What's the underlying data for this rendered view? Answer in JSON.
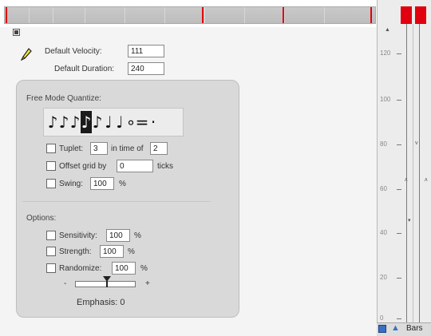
{
  "default_velocity": {
    "label": "Default Velocity:",
    "value": "111"
  },
  "default_duration": {
    "label": "Default Duration:",
    "value": "240"
  },
  "quantize": {
    "title": "Free Mode Quantize:",
    "notes": [
      {
        "glyph": "♪",
        "icon": "sixty-fourth-note-icon",
        "selected": false
      },
      {
        "glyph": "♪",
        "icon": "thirty-second-note-icon",
        "selected": false
      },
      {
        "glyph": "♪",
        "icon": "sixteenth-note-icon",
        "selected": false
      },
      {
        "glyph": "♪",
        "icon": "eighth-note-icon",
        "selected": true
      },
      {
        "glyph": "♪",
        "icon": "eighth-note-icon",
        "selected": false
      },
      {
        "glyph": "♩",
        "icon": "quarter-note-icon",
        "selected": false
      },
      {
        "glyph": "♩",
        "icon": "half-note-icon",
        "selected": false
      },
      {
        "glyph": "∘",
        "icon": "whole-note-icon",
        "selected": false
      },
      {
        "glyph": "=",
        "icon": "double-whole-note-icon",
        "selected": false
      },
      {
        "glyph": "·",
        "icon": "dotted-modifier-icon",
        "selected": false
      }
    ],
    "tuplet": {
      "label": "Tuplet:",
      "value": "3",
      "mid_label": "in time of",
      "value2": "2",
      "checked": false
    },
    "offset": {
      "label": "Offset grid by",
      "value": "0",
      "unit": "ticks",
      "checked": false
    },
    "swing": {
      "label": "Swing:",
      "value": "100",
      "unit": "%",
      "checked": false
    }
  },
  "options": {
    "title": "Options:",
    "sensitivity": {
      "label": "Sensitivity:",
      "value": "100",
      "unit": "%",
      "checked": false
    },
    "strength": {
      "label": "Strength:",
      "value": "100",
      "unit": "%",
      "checked": false
    },
    "randomize": {
      "label": "Randomize:",
      "value": "100",
      "unit": "%",
      "checked": false
    },
    "emphasis": {
      "minus": "-",
      "plus": "+",
      "label": "Emphasis: 0",
      "value": 0.5
    }
  },
  "velocity_ruler": {
    "ticks": [
      "120",
      "100",
      "80",
      "60",
      "40",
      "20",
      "0"
    ],
    "bottom_label": "Bars"
  },
  "colors": {
    "accent_red": "#e00010",
    "panel_bg": "#d9d9d9"
  }
}
